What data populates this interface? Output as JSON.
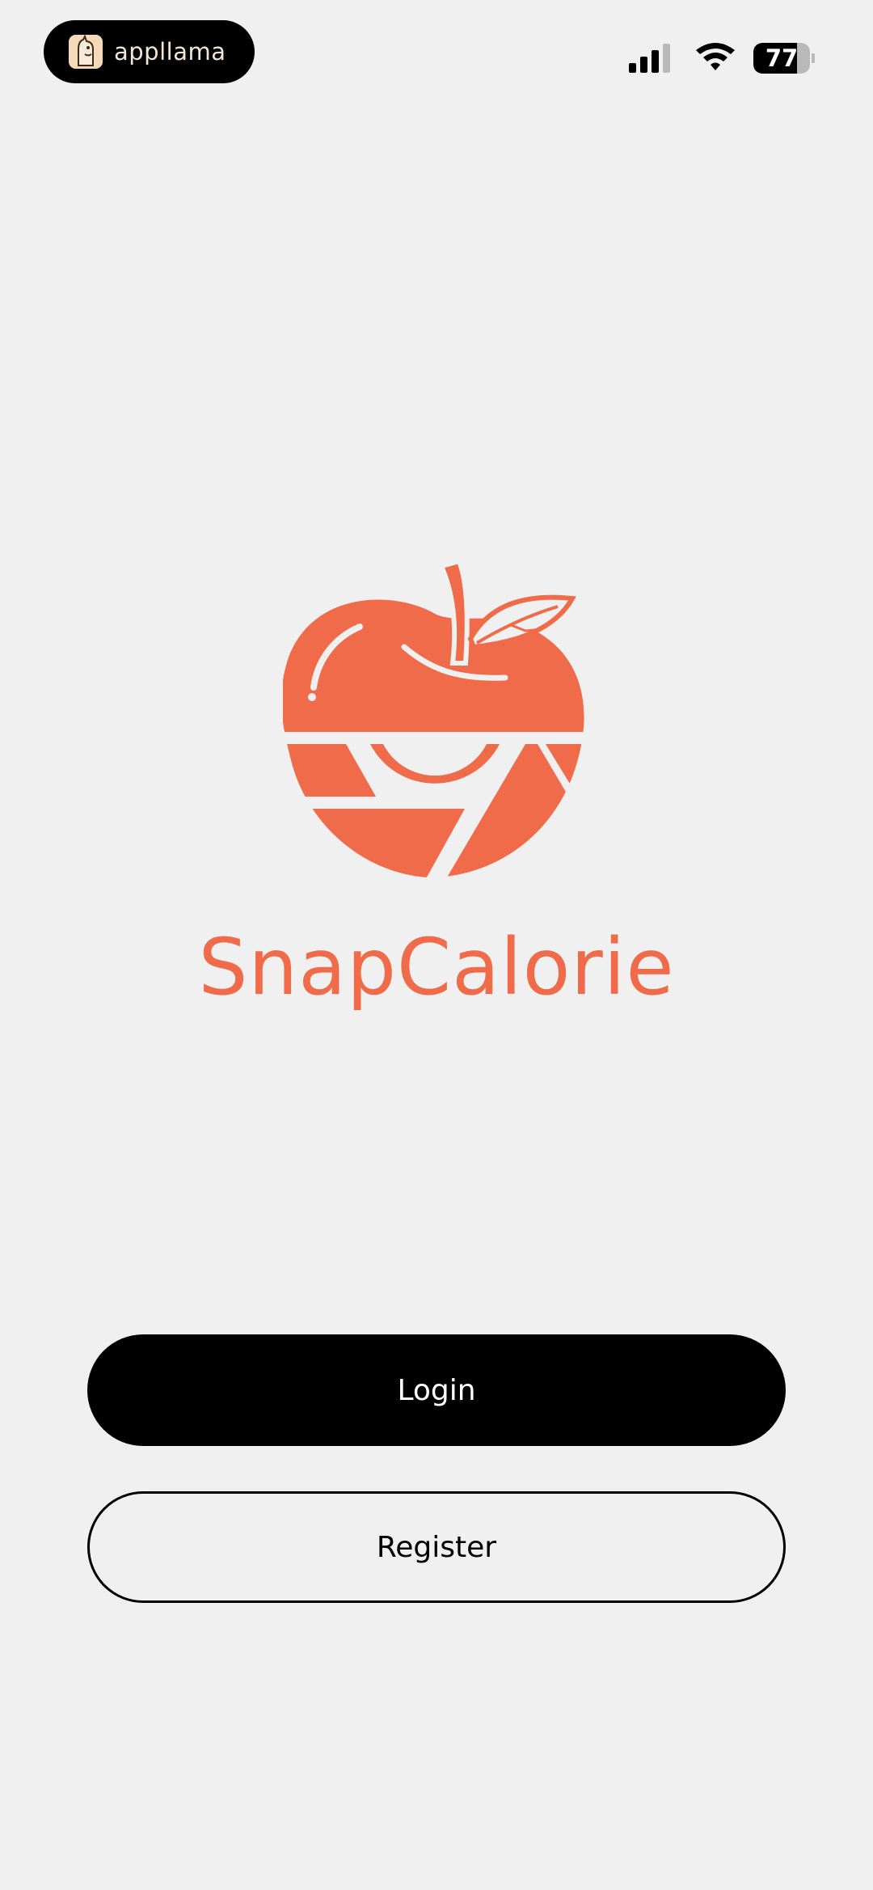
{
  "status_bar": {
    "app_badge_text": "appllama",
    "battery_level": "77",
    "battery_fraction": 0.77,
    "signal_bars_active": 3,
    "signal_bars_total": 4,
    "icons": [
      "llama-icon",
      "signal-icon",
      "wifi-icon",
      "battery-icon"
    ]
  },
  "brand": {
    "name": "SnapCalorie",
    "logo_icon": "apple-camera-shutter-icon",
    "color": "#ef6b4a"
  },
  "actions": {
    "login_label": "Login",
    "register_label": "Register"
  }
}
